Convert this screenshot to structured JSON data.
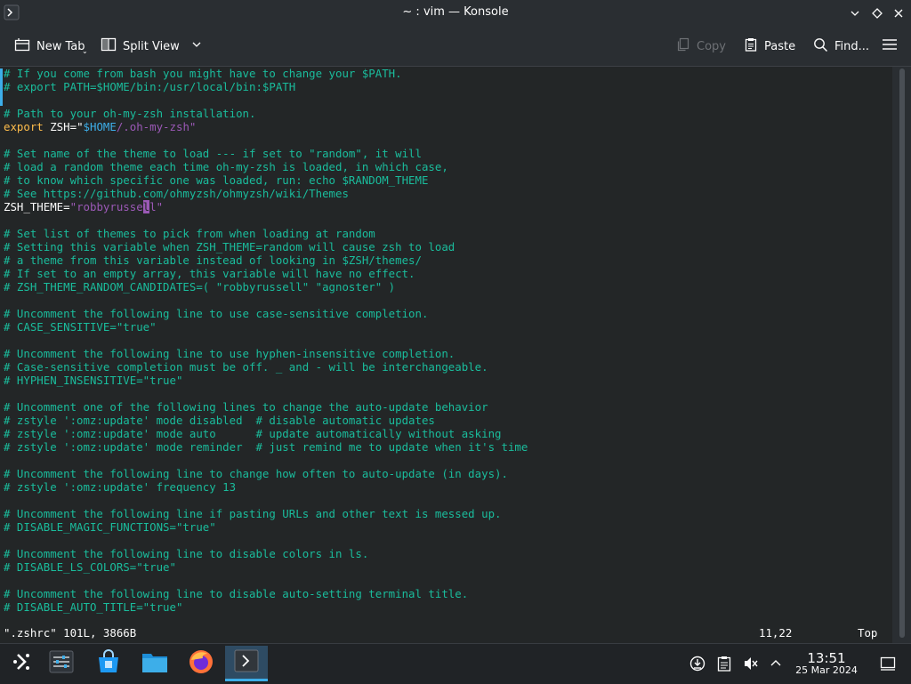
{
  "window": {
    "title": "~ : vim — Konsole",
    "app_icon": "terminal-icon",
    "controls": [
      "minimize-icon",
      "maximize-icon",
      "close-icon"
    ]
  },
  "toolbar": {
    "new_tab": "New Tab",
    "split_view": "Split View",
    "copy": "Copy",
    "paste": "Paste",
    "find": "Find...",
    "icons": [
      "new-tab-icon",
      "split-view-icon",
      "chevron-down-icon",
      "copy-icon",
      "paste-icon",
      "search-icon",
      "hamburger-menu-icon"
    ]
  },
  "editor": {
    "lines": [
      {
        "text": "# If you come from bash you might have to change your $PATH."
      },
      {
        "text": "# export PATH=$HOME/bin:/usr/local/bin:$PATH"
      },
      {
        "text": ""
      },
      {
        "text": "# Path to your oh-my-zsh installation."
      },
      {
        "text": "",
        "seg": {
          "kw": "export",
          "plain": " ZSH=\"",
          "var": "$HOME",
          "str": "/.oh-my-zsh\""
        }
      },
      {
        "text": ""
      },
      {
        "text": "# Set name of the theme to load --- if set to \"random\", it will"
      },
      {
        "text": "# load a random theme each time oh-my-zsh is loaded, in which case,"
      },
      {
        "text": "# to know which specific one was loaded, run: echo $RANDOM_THEME"
      },
      {
        "text": "# See https://github.com/ohmyzsh/ohmyzsh/wiki/Themes"
      },
      {
        "text": "",
        "seg": {
          "plain": "ZSH_THEME=",
          "str": "\"robbyrusse",
          "cursor": "l",
          "str2": "l\""
        }
      },
      {
        "text": ""
      },
      {
        "text": "# Set list of themes to pick from when loading at random"
      },
      {
        "text": "# Setting this variable when ZSH_THEME=random will cause zsh to load"
      },
      {
        "text": "# a theme from this variable instead of looking in $ZSH/themes/"
      },
      {
        "text": "# If set to an empty array, this variable will have no effect."
      },
      {
        "text": "# ZSH_THEME_RANDOM_CANDIDATES=( \"robbyrussell\" \"agnoster\" )"
      },
      {
        "text": ""
      },
      {
        "text": "# Uncomment the following line to use case-sensitive completion."
      },
      {
        "text": "# CASE_SENSITIVE=\"true\""
      },
      {
        "text": ""
      },
      {
        "text": "# Uncomment the following line to use hyphen-insensitive completion."
      },
      {
        "text": "# Case-sensitive completion must be off. _ and - will be interchangeable."
      },
      {
        "text": "# HYPHEN_INSENSITIVE=\"true\""
      },
      {
        "text": ""
      },
      {
        "text": "# Uncomment one of the following lines to change the auto-update behavior"
      },
      {
        "text": "# zstyle ':omz:update' mode disabled  # disable automatic updates"
      },
      {
        "text": "# zstyle ':omz:update' mode auto      # update automatically without asking"
      },
      {
        "text": "# zstyle ':omz:update' mode reminder  # just remind me to update when it's time"
      },
      {
        "text": ""
      },
      {
        "text": "# Uncomment the following line to change how often to auto-update (in days)."
      },
      {
        "text": "# zstyle ':omz:update' frequency 13"
      },
      {
        "text": ""
      },
      {
        "text": "# Uncomment the following line if pasting URLs and other text is messed up."
      },
      {
        "text": "# DISABLE_MAGIC_FUNCTIONS=\"true\""
      },
      {
        "text": ""
      },
      {
        "text": "# Uncomment the following line to disable colors in ls."
      },
      {
        "text": "# DISABLE_LS_COLORS=\"true\""
      },
      {
        "text": ""
      },
      {
        "text": "# Uncomment the following line to disable auto-setting terminal title."
      },
      {
        "text": "# DISABLE_AUTO_TITLE=\"true\""
      }
    ]
  },
  "status": {
    "file": "\".zshrc\" 101L, 3866B",
    "position": "11,22",
    "scroll": "Top"
  },
  "taskbar": {
    "items": [
      "application-launcher-icon",
      "system-settings-icon",
      "discover-store-icon",
      "file-manager-icon",
      "firefox-icon",
      "konsole-icon"
    ],
    "tray": [
      "network-icon",
      "clipboard-icon",
      "volume-muted-icon",
      "tray-expand-icon",
      "show-desktop-icon"
    ],
    "time": "13:51",
    "date": "25 Mar 2024"
  },
  "colors": {
    "comment": "#1abc9c",
    "keyword": "#fdbc4b",
    "string": "#9b59b6",
    "variable": "#3daee9",
    "background": "#232627",
    "accent": "#3daee9"
  }
}
